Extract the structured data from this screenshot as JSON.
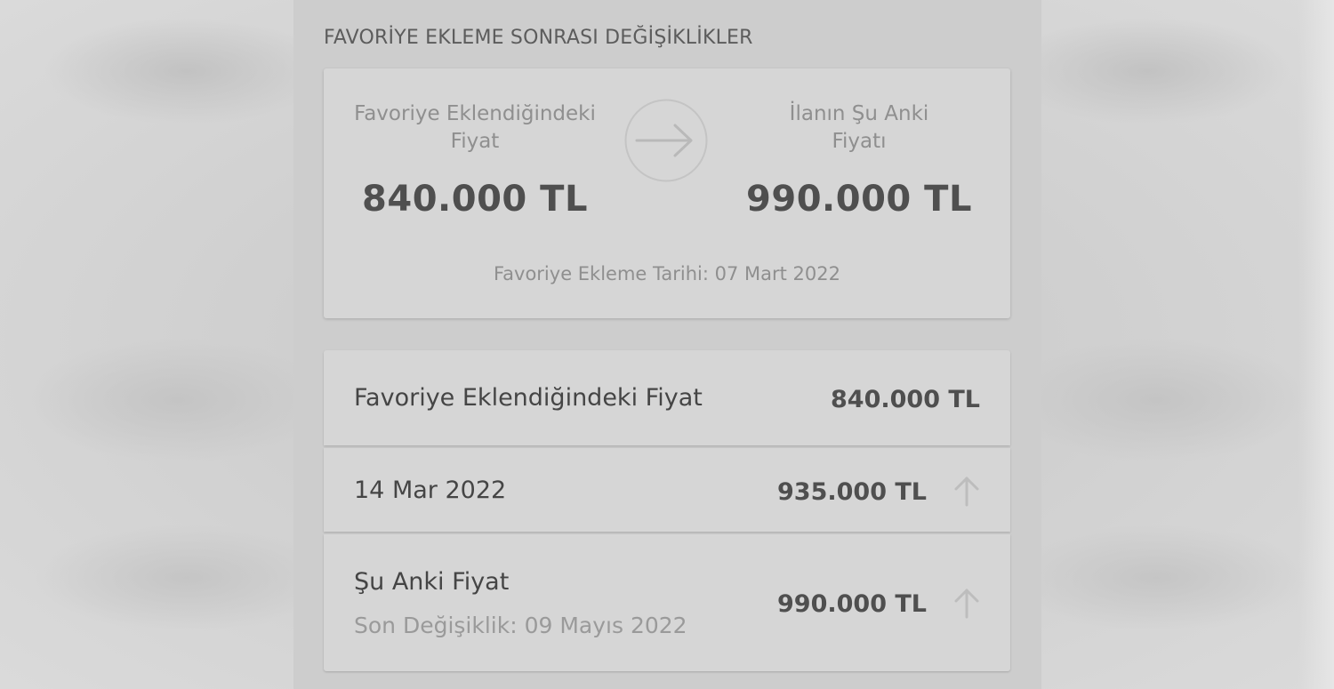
{
  "section_title": "FAVORİYE EKLEME SONRASI DEĞİŞİKLİKLER",
  "summary": {
    "left_label": "Favoriye Eklendiğindeki Fiyat",
    "left_price": "840.000 TL",
    "arrow_icon": "arrow-right-icon",
    "right_label": "İlanın Şu Anki Fiyatı",
    "right_price": "990.000 TL",
    "date_text": "Favoriye Ekleme Tarihi: 07 Mart 2022"
  },
  "history": [
    {
      "label": "Favoriye Eklendiğindeki Fiyat",
      "price": "840.000 TL"
    },
    {
      "label": "14 Mar 2022",
      "price": "935.000 TL",
      "trend_icon": "arrow-up-icon"
    },
    {
      "label": "Şu Anki Fiyat",
      "sublabel": "Son Değişiklik: 09 Mayıs 2022",
      "price": "990.000 TL",
      "trend_icon": "arrow-up-icon"
    }
  ],
  "colors": {
    "panel_bg": "#cdcdcd",
    "card_bg": "#d6d6d6",
    "text_dark": "#4f4f4f",
    "text_muted": "#8f8f8f"
  }
}
